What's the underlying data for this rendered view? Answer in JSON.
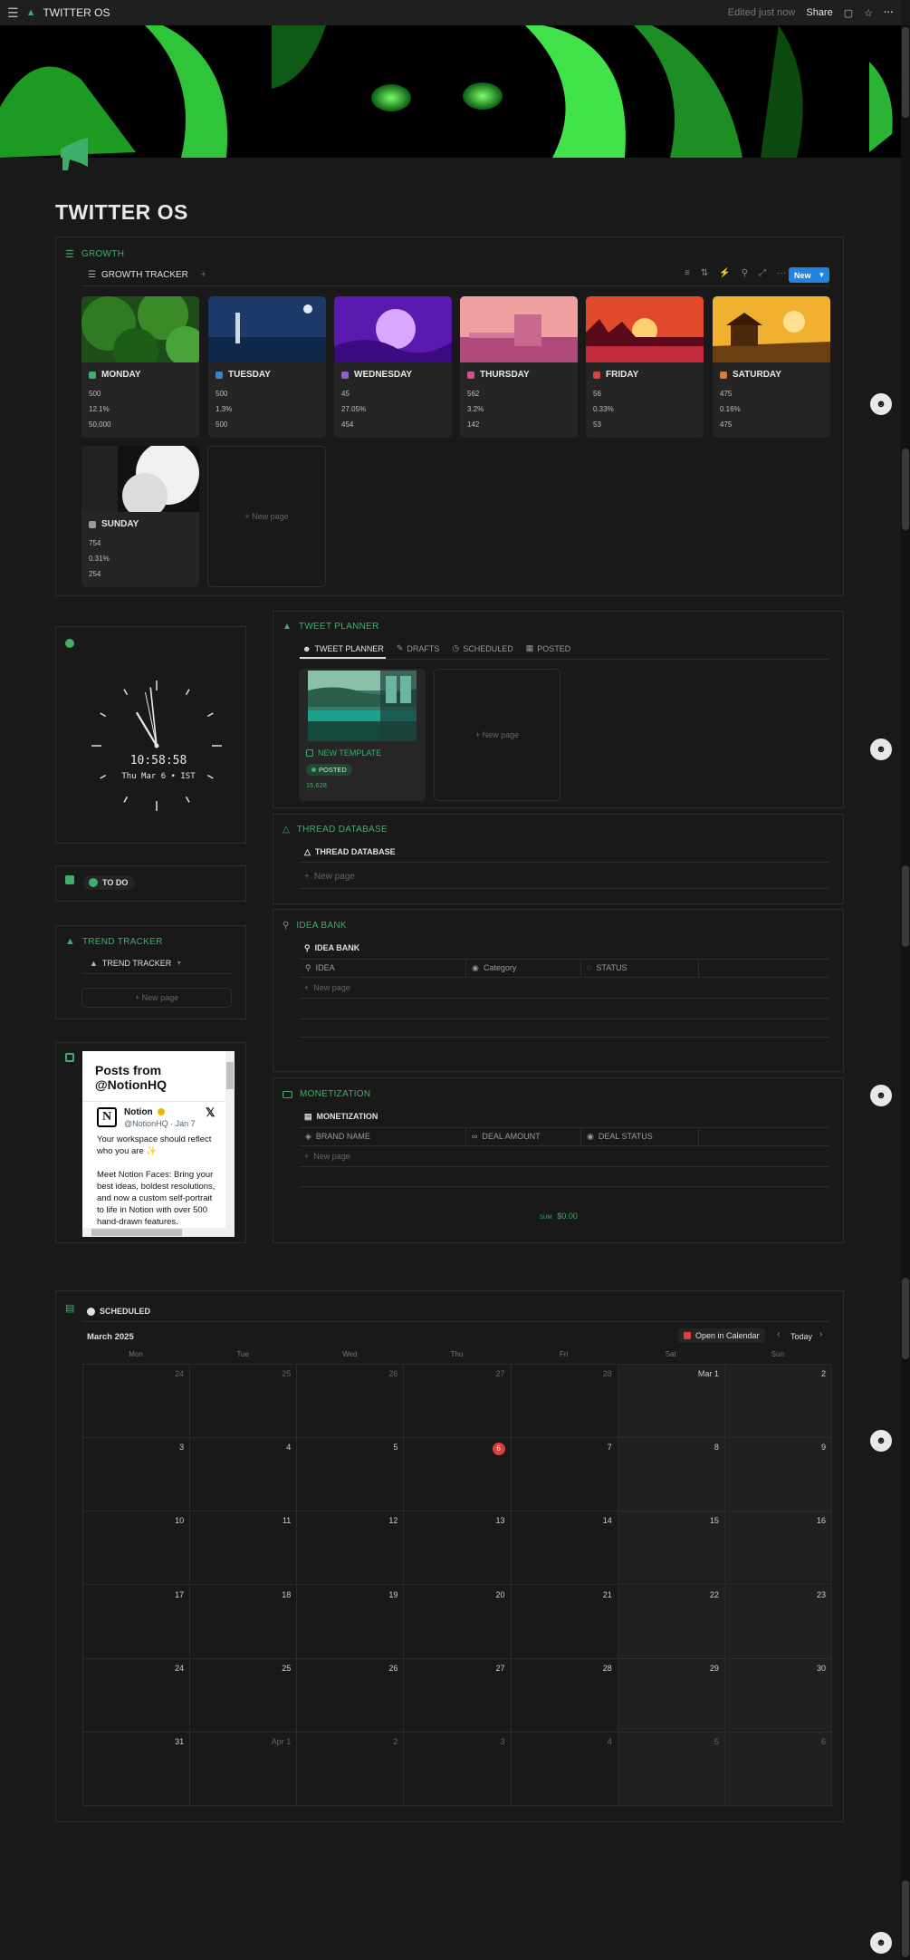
{
  "app": {
    "title": "TWITTER OS",
    "edited": "Edited just now",
    "share": "Share"
  },
  "page": {
    "title": "TWITTER OS"
  },
  "growth": {
    "label": "GROWTH",
    "view": "GROWTH TRACKER",
    "add": "+",
    "new_button": "New",
    "new_page": "+ New page",
    "cards": [
      {
        "name": "MONDAY",
        "v1": "500",
        "v2": "12.1%",
        "v3": "50,000",
        "color": "#3fae6a"
      },
      {
        "name": "TUESDAY",
        "v1": "500",
        "v2": "1.3%",
        "v3": "500",
        "color": "#3b82d6"
      },
      {
        "name": "WEDNESDAY",
        "v1": "45",
        "v2": "27.05%",
        "v3": "454",
        "color": "#9b59d0"
      },
      {
        "name": "THURSDAY",
        "v1": "562",
        "v2": "3.2%",
        "v3": "142",
        "color": "#d0508f"
      },
      {
        "name": "FRIDAY",
        "v1": "56",
        "v2": "0.33%",
        "v3": "53",
        "color": "#d04545"
      },
      {
        "name": "SATURDAY",
        "v1": "475",
        "v2": "0.16%",
        "v3": "475",
        "color": "#e07a2e"
      },
      {
        "name": "SUNDAY",
        "v1": "754",
        "v2": "0.31%",
        "v3": "254",
        "color": "#9a9a9a"
      }
    ]
  },
  "clock": {
    "time": "10:58:58",
    "date": "Thu Mar 6 • IST"
  },
  "todo": {
    "label": "TO DO"
  },
  "trend": {
    "label": "TREND TRACKER",
    "view": "TREND TRACKER",
    "new_page": "+ New page"
  },
  "widget": {
    "title": "Posts from @NotionHQ",
    "name": "Notion",
    "handle": "@NotionHQ · Jan 7",
    "text1": "Your workspace should reflect who you are ✨",
    "text2": "Meet Notion Faces: Bring your best ideas, boldest resolutions, and now a custom self-portrait to life in Notion with over 500 hand-drawn features."
  },
  "tweet_planner": {
    "label": "TWEET PLANNER",
    "tabs": [
      "TWEET PLANNER",
      "DRAFTS",
      "SCHEDULED",
      "POSTED"
    ],
    "card": {
      "name": "NEW TEMPLATE",
      "status": "POSTED",
      "value": "15,628"
    },
    "new_page": "+ New page"
  },
  "thread_db": {
    "label": "THREAD DATABASE",
    "view": "THREAD DATABASE",
    "new_page": "New page"
  },
  "idea_bank": {
    "label": "IDEA BANK",
    "view": "IDEA BANK",
    "columns": [
      "IDEA",
      "Category",
      "STATUS"
    ],
    "new_page": "New page"
  },
  "monetization": {
    "label": "MONETIZATION",
    "view": "MONETIZATION",
    "columns": [
      "BRAND NAME",
      "DEAL AMOUNT",
      "DEAL STATUS"
    ],
    "new_page": "New page",
    "sum_label": "SUM",
    "sum_value": "$0.00"
  },
  "calendar": {
    "view": "SCHEDULED",
    "month": "March 2025",
    "open": "Open in Calendar",
    "today": "Today",
    "weekdays": [
      "Mon",
      "Tue",
      "Wed",
      "Thu",
      "Fri",
      "Sat",
      "Sun"
    ],
    "days": [
      "24",
      "25",
      "26",
      "27",
      "28",
      "Mar 1",
      "2",
      "3",
      "4",
      "5",
      "6",
      "7",
      "8",
      "9",
      "10",
      "11",
      "12",
      "13",
      "14",
      "15",
      "16",
      "17",
      "18",
      "19",
      "20",
      "21",
      "22",
      "23",
      "24",
      "25",
      "26",
      "27",
      "28",
      "29",
      "30",
      "31",
      "Apr 1",
      "2",
      "3",
      "4",
      "5",
      "6"
    ],
    "today_index": 10
  },
  "colors": {
    "accent": "#3fae6a",
    "blue": "#2383e2",
    "today": "#e03e3e"
  }
}
